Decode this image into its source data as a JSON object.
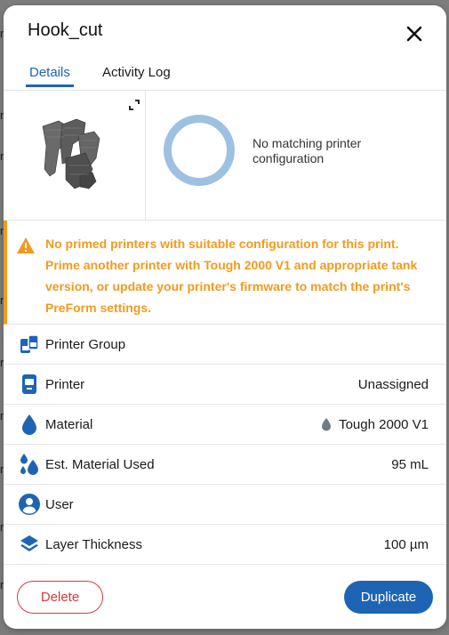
{
  "background": {
    "fragments": [
      "r",
      "r",
      "r",
      "r",
      "r",
      "r",
      "r",
      "r",
      "r",
      "r"
    ]
  },
  "dialog": {
    "title": "Hook_cut",
    "tabs": [
      {
        "label": "Details",
        "active": true
      },
      {
        "label": "Activity Log",
        "active": false
      }
    ],
    "status": {
      "ring_color": "#9ec1e2",
      "text": "No matching printer configuration"
    },
    "warning": {
      "color": "#f39a1e",
      "text": "No primed printers with suitable configuration for this print. Prime another printer with Tough 2000 V1 and appropriate tank version, or update your printer's firmware to match the print's PreForm settings."
    },
    "rows": [
      {
        "icon": "printer-group-icon",
        "label": "Printer Group",
        "value": ""
      },
      {
        "icon": "printer-icon",
        "label": "Printer",
        "value": "Unassigned"
      },
      {
        "icon": "material-drop-icon",
        "label": "Material",
        "value": "Tough 2000 V1",
        "value_icon": "resin-drop-icon"
      },
      {
        "icon": "material-used-icon",
        "label": "Est. Material Used",
        "value": "95 mL"
      },
      {
        "icon": "user-icon",
        "label": "User",
        "value": ""
      },
      {
        "icon": "layers-icon",
        "label": "Layer Thickness",
        "value": "100 µm"
      }
    ],
    "buttons": {
      "delete": "Delete",
      "duplicate": "Duplicate"
    },
    "colors": {
      "accent": "#1e64b4",
      "danger": "#d9393e",
      "warning": "#f39a1e"
    }
  }
}
